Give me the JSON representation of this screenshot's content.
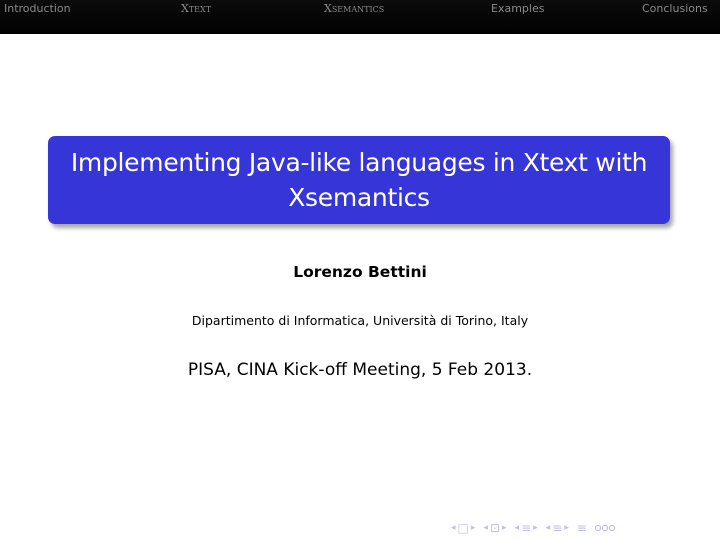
{
  "nav": {
    "introduction": "Introduction",
    "xtext": "Xtext",
    "xsemantics": "Xsemantics",
    "examples": "Examples",
    "conclusions": "Conclusions"
  },
  "title": "Implementing Java-like languages in Xtext with Xsemantics",
  "author": "Lorenzo Bettini",
  "institute": "Dipartimento di Informatica, Università di Torino, Italy",
  "date": "PISA, CINA Kick-off Meeting, 5 Feb 2013.",
  "beamer_nav": {
    "left": "◂",
    "right": "▸",
    "frame": "□",
    "subsection": "⊡",
    "section": "≡",
    "equiv": "≡",
    "icons": [
      "frame-nav-icon",
      "subsection-nav-icon",
      "section-nav-icon",
      "document-nav-icon",
      "search-icon"
    ]
  },
  "colors": {
    "navbar_bg": "#000000",
    "title_bg": "#3535d8",
    "nav_text": "#8a8a8a",
    "beamer_nav": "#c0c0e4"
  }
}
